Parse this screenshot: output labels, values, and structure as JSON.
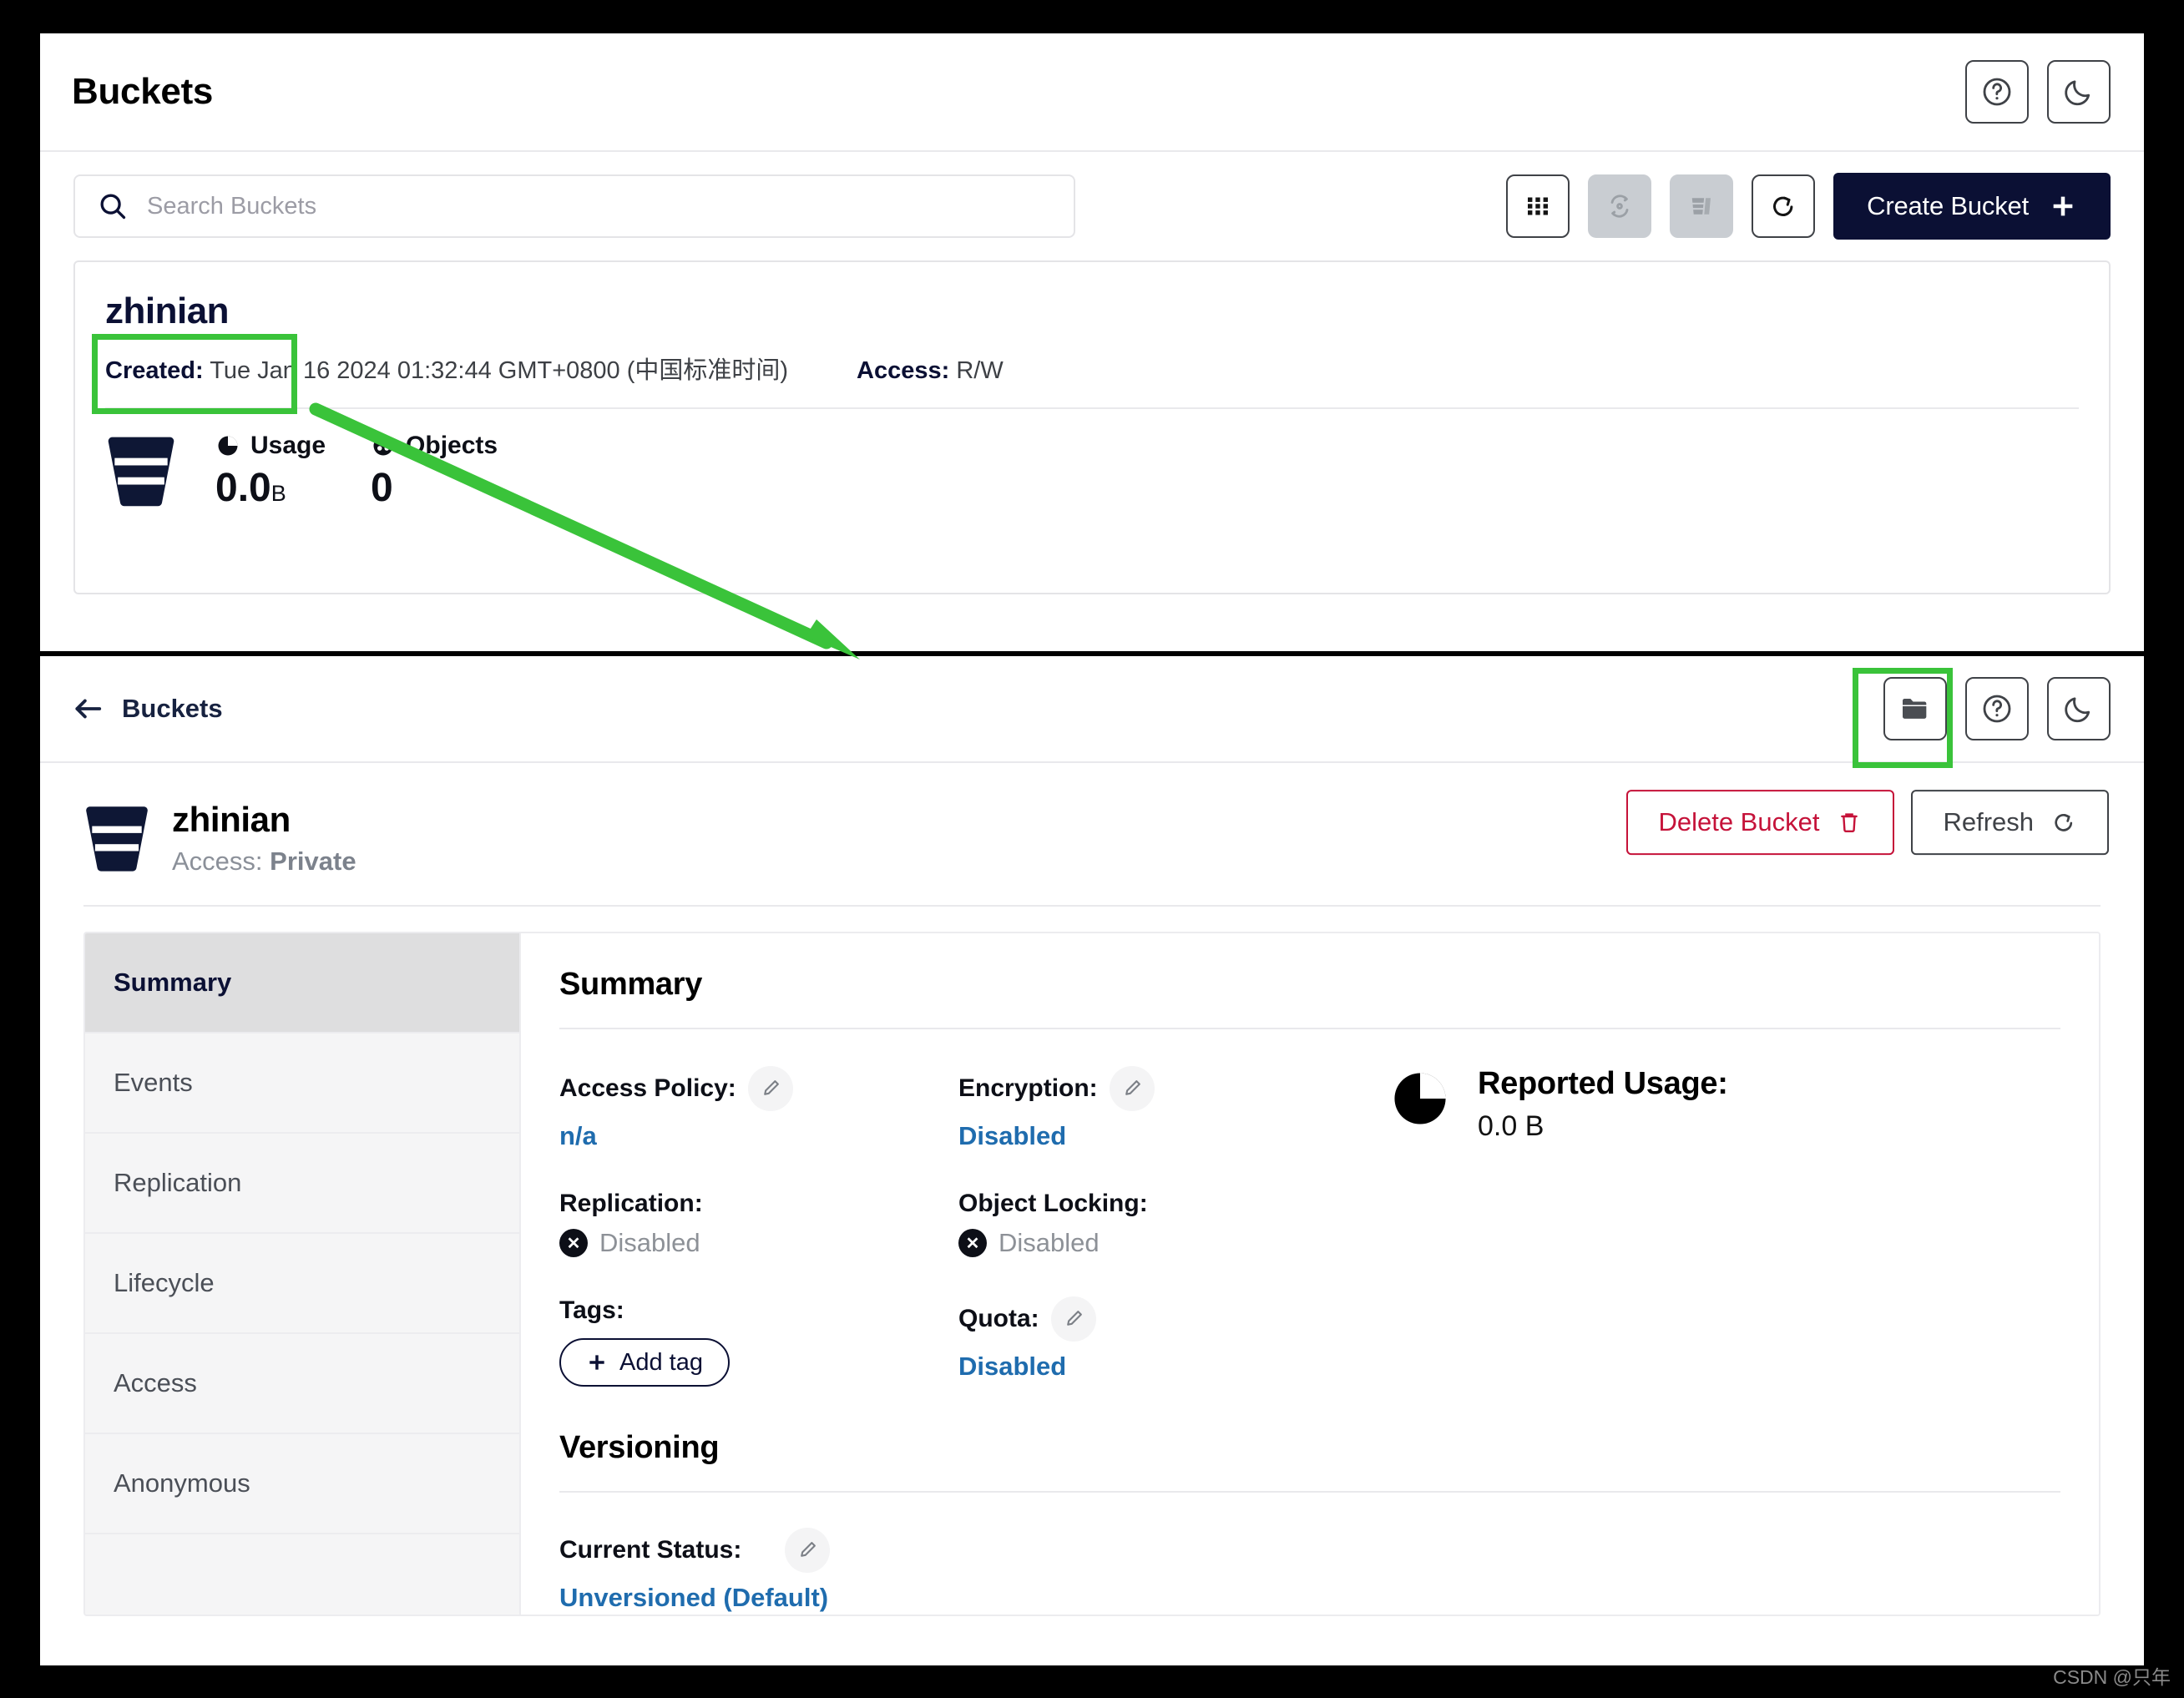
{
  "top_window": {
    "title": "Buckets",
    "header_icons": [
      {
        "name": "help-icon",
        "glyph": "?"
      },
      {
        "name": "dark-mode-icon",
        "glyph": "moon"
      }
    ],
    "search": {
      "placeholder": "Search Buckets",
      "value": "",
      "icon": "search-icon"
    },
    "toolbar_buttons": [
      {
        "name": "grid-view-button",
        "icon": "grid-icon",
        "disabled": false
      },
      {
        "name": "replication-button",
        "icon": "sync-icon",
        "disabled": true
      },
      {
        "name": "delete-selected-button",
        "icon": "buckets-icon",
        "disabled": true
      },
      {
        "name": "refresh-button",
        "icon": "refresh-icon",
        "disabled": false
      }
    ],
    "create_button": {
      "label": "Create Bucket",
      "icon": "plus-icon",
      "background": "#0b1034"
    },
    "bucket_card": {
      "name": "zhinian",
      "created_label": "Created:",
      "created_value": "Tue Jan 16 2024 01:32:44 GMT+0800 (中国标准时间)",
      "access_label": "Access:",
      "access_value": "R/W",
      "usage_label": "Usage",
      "usage_value": "0.0",
      "usage_unit": "B",
      "objects_label": "Objects",
      "objects_value": "0"
    }
  },
  "bottom_window": {
    "back_label": "Buckets",
    "header_icons": [
      {
        "name": "object-browser-icon",
        "glyph": "folder"
      },
      {
        "name": "help-icon",
        "glyph": "?"
      },
      {
        "name": "dark-mode-icon",
        "glyph": "moon"
      }
    ],
    "bucket": {
      "name": "zhinian",
      "access_label": "Access:",
      "access_value": "Private"
    },
    "actions": {
      "delete_label": "Delete Bucket",
      "delete_icon": "trash-icon",
      "delete_color": "#c51239",
      "refresh_label": "Refresh",
      "refresh_icon": "refresh-icon"
    },
    "nav_items": [
      {
        "label": "Summary",
        "active": true
      },
      {
        "label": "Events",
        "active": false
      },
      {
        "label": "Replication",
        "active": false
      },
      {
        "label": "Lifecycle",
        "active": false
      },
      {
        "label": "Access",
        "active": false
      },
      {
        "label": "Anonymous",
        "active": false
      }
    ],
    "summary": {
      "heading": "Summary",
      "access_policy": {
        "label": "Access Policy:",
        "value": "n/a",
        "editable": true
      },
      "replication": {
        "label": "Replication:",
        "value": "Disabled",
        "editable": false
      },
      "tags": {
        "label": "Tags:",
        "add_label": "Add tag"
      },
      "encryption": {
        "label": "Encryption:",
        "value": "Disabled",
        "editable": true
      },
      "object_locking": {
        "label": "Object Locking:",
        "value": "Disabled",
        "editable": false
      },
      "quota": {
        "label": "Quota:",
        "value": "Disabled",
        "editable": true
      },
      "reported_usage": {
        "label": "Reported Usage:",
        "value": "0.0 B",
        "icon": "pie-chart-icon"
      }
    },
    "versioning": {
      "heading": "Versioning",
      "status_label": "Current Status:",
      "status_value": "Unversioned (Default)",
      "editable": true
    }
  },
  "annotations": {
    "highlight_color": "#3ac33a",
    "watermark": "CSDN @只年"
  }
}
